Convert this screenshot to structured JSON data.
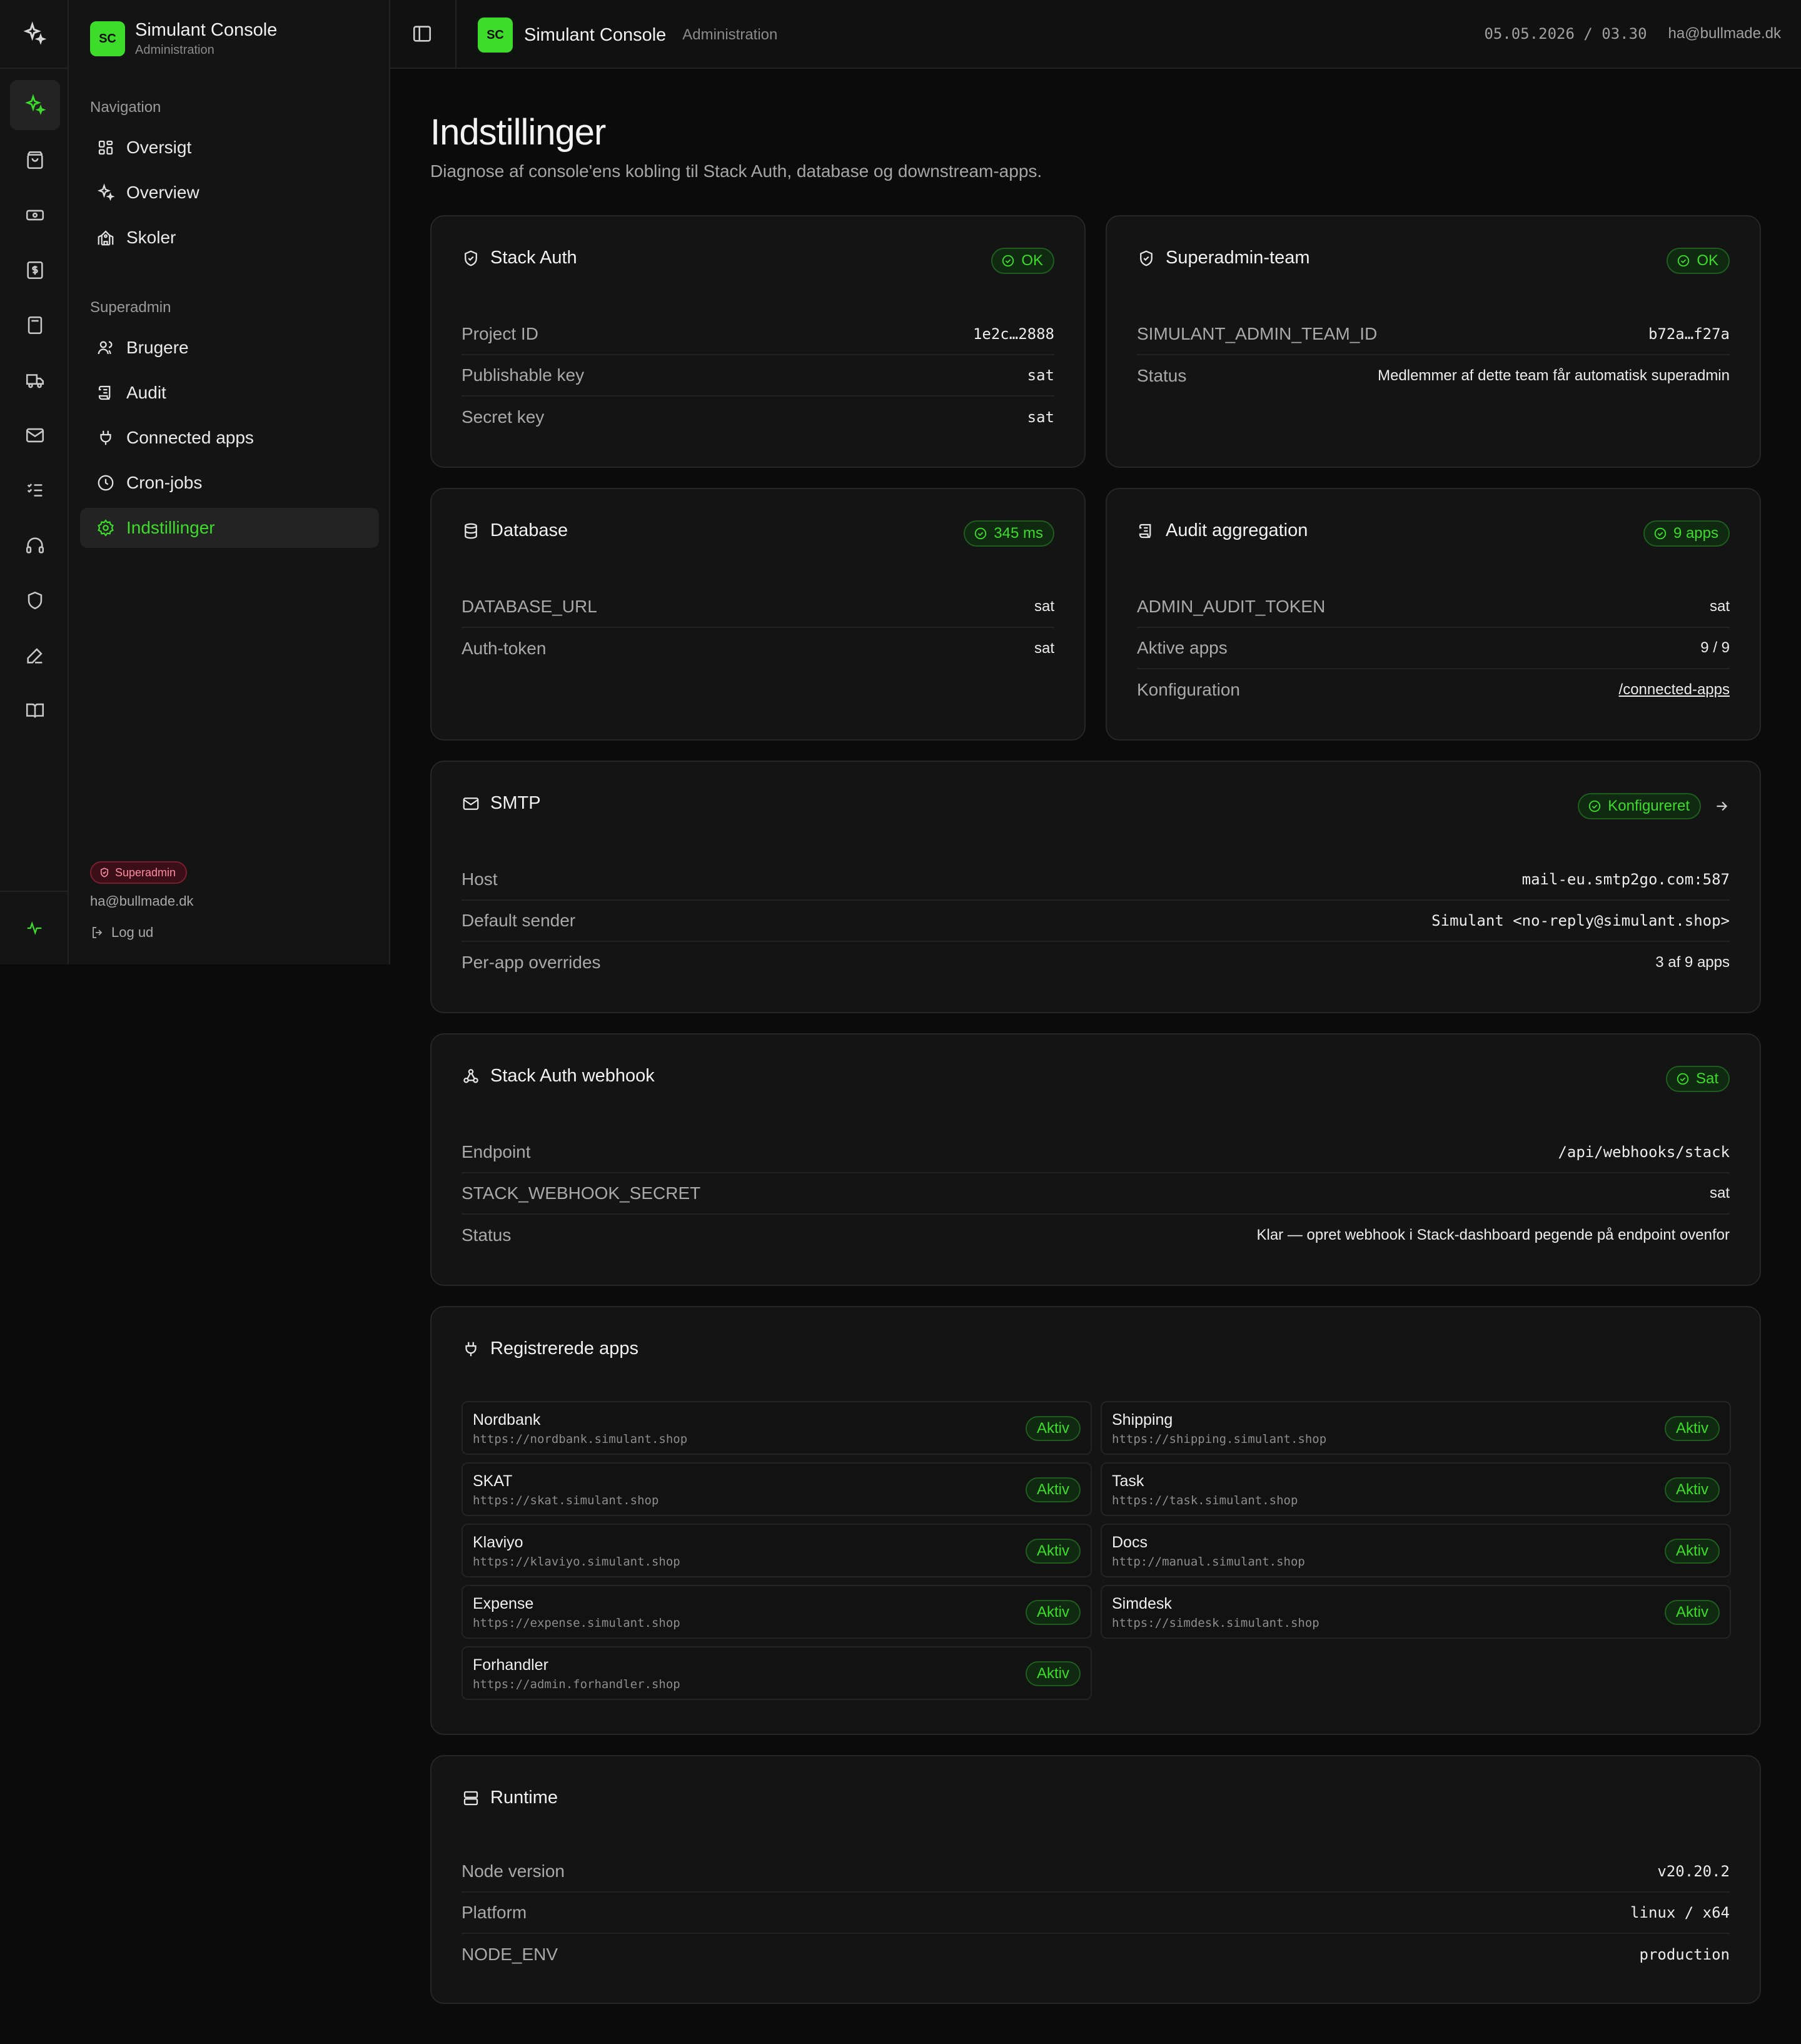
{
  "app": {
    "badge": "SC",
    "name": "Simulant Console",
    "subtitle": "Administration"
  },
  "topbar": {
    "date_time": "05.05.2026 / 03.30",
    "user_email": "ha@bullmade.dk"
  },
  "sidebar": {
    "nav_heading": "Navigation",
    "nav_items": [
      {
        "label": "Oversigt",
        "icon": "grid-icon"
      },
      {
        "label": "Overview",
        "icon": "sparkles-icon"
      },
      {
        "label": "Skoler",
        "icon": "school-icon"
      }
    ],
    "superadmin_heading": "Superadmin",
    "superadmin_items": [
      {
        "label": "Brugere",
        "icon": "users-icon"
      },
      {
        "label": "Audit",
        "icon": "scroll-icon"
      },
      {
        "label": "Connected apps",
        "icon": "plug-icon"
      },
      {
        "label": "Cron-jobs",
        "icon": "clock-icon"
      },
      {
        "label": "Indstillinger",
        "icon": "gear-icon",
        "active": true
      }
    ],
    "role_badge": "Superadmin",
    "email": "ha@bullmade.dk",
    "logout": "Log ud"
  },
  "page": {
    "title": "Indstillinger",
    "subtitle": "Diagnose af console'ens kobling til Stack Auth, database og downstream-apps."
  },
  "cards": {
    "stack_auth": {
      "title": "Stack Auth",
      "status": "OK",
      "rows": [
        {
          "key": "Project ID",
          "value": "1e2c…2888"
        },
        {
          "key": "Publishable key",
          "value": "sat"
        },
        {
          "key": "Secret key",
          "value": "sat"
        }
      ]
    },
    "superadmin_team": {
      "title": "Superadmin-team",
      "status": "OK",
      "rows": [
        {
          "key": "SIMULANT_ADMIN_TEAM_ID",
          "value": "b72a…f27a"
        },
        {
          "key": "Status",
          "value": "Medlemmer af dette team får automatisk superadmin"
        }
      ]
    },
    "database": {
      "title": "Database",
      "status": "345 ms",
      "rows": [
        {
          "key": "DATABASE_URL",
          "value": "sat"
        },
        {
          "key": "Auth-token",
          "value": "sat"
        }
      ]
    },
    "audit": {
      "title": "Audit aggregation",
      "status": "9 apps",
      "rows": [
        {
          "key": "ADMIN_AUDIT_TOKEN",
          "value": "sat"
        },
        {
          "key": "Aktive apps",
          "value": "9 / 9"
        },
        {
          "key": "Konfiguration",
          "value": "/connected-apps"
        }
      ]
    },
    "smtp": {
      "title": "SMTP",
      "status": "Konfigureret",
      "rows": [
        {
          "key": "Host",
          "value": "mail-eu.smtp2go.com:587"
        },
        {
          "key": "Default sender",
          "value": "Simulant <no-reply@simulant.shop>"
        },
        {
          "key": "Per-app overrides",
          "value": "3 af 9 apps"
        }
      ]
    },
    "webhook": {
      "title": "Stack Auth webhook",
      "status": "Sat",
      "rows": [
        {
          "key": "Endpoint",
          "value": "/api/webhooks/stack"
        },
        {
          "key": "STACK_WEBHOOK_SECRET",
          "value": "sat"
        },
        {
          "key": "Status",
          "value": "Klar — opret webhook i Stack-dashboard pegende på endpoint ovenfor"
        }
      ]
    },
    "registered_apps": {
      "title": "Registrerede apps",
      "apps": [
        {
          "name": "Nordbank",
          "url": "https://nordbank.simulant.shop",
          "status": "Aktiv"
        },
        {
          "name": "Shipping",
          "url": "https://shipping.simulant.shop",
          "status": "Aktiv"
        },
        {
          "name": "SKAT",
          "url": "https://skat.simulant.shop",
          "status": "Aktiv"
        },
        {
          "name": "Task",
          "url": "https://task.simulant.shop",
          "status": "Aktiv"
        },
        {
          "name": "Klaviyo",
          "url": "https://klaviyo.simulant.shop",
          "status": "Aktiv"
        },
        {
          "name": "Docs",
          "url": "http://manual.simulant.shop",
          "status": "Aktiv"
        },
        {
          "name": "Expense",
          "url": "https://expense.simulant.shop",
          "status": "Aktiv"
        },
        {
          "name": "Simdesk",
          "url": "https://simdesk.simulant.shop",
          "status": "Aktiv"
        },
        {
          "name": "Forhandler",
          "url": "https://admin.forhandler.shop",
          "status": "Aktiv"
        }
      ]
    },
    "runtime": {
      "title": "Runtime",
      "rows": [
        {
          "key": "Node version",
          "value": "v20.20.2"
        },
        {
          "key": "Platform",
          "value": "linux / x64"
        },
        {
          "key": "NODE_ENV",
          "value": "production"
        }
      ]
    }
  },
  "colors": {
    "accent": "#3ddc2a",
    "background": "#0b0b0b",
    "card": "#141414",
    "danger": "#ff8aa0"
  }
}
